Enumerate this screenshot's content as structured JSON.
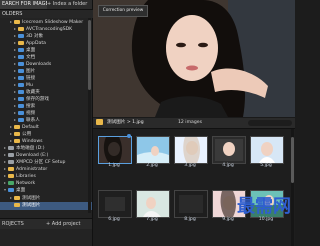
{
  "left_panel": {
    "tab_search": "EARCH FOR IMAGES",
    "tab_index": "+ Index a folder",
    "folders_heading": "OLDERS",
    "tree": [
      {
        "label": "Icecream Slideshow Maker",
        "indent": 1,
        "color": "yellow"
      },
      {
        "label": "AVCTranscodingSDK",
        "indent": 2,
        "color": "yellow"
      },
      {
        "label": "3D 对象",
        "indent": 2,
        "color": "blue"
      },
      {
        "label": "AppData",
        "indent": 2,
        "color": "yellow"
      },
      {
        "label": "桌面",
        "indent": 2,
        "color": "blue"
      },
      {
        "label": "文档",
        "indent": 2,
        "color": "blue"
      },
      {
        "label": "Downloads",
        "indent": 2,
        "color": "blue"
      },
      {
        "label": "图片",
        "indent": 2,
        "color": "blue"
      },
      {
        "label": "链接",
        "indent": 2,
        "color": "blue"
      },
      {
        "label": "Mu",
        "indent": 2,
        "color": "blue"
      },
      {
        "label": "收藏夹",
        "indent": 2,
        "color": "blue"
      },
      {
        "label": "保存的游戏",
        "indent": 2,
        "color": "blue"
      },
      {
        "label": "搜索",
        "indent": 2,
        "color": "blue"
      },
      {
        "label": "视频",
        "indent": 2,
        "color": "blue"
      },
      {
        "label": "联系人",
        "indent": 2,
        "color": "blue"
      },
      {
        "label": "Default",
        "indent": 1,
        "color": "yellow"
      },
      {
        "label": "公用",
        "indent": 1,
        "color": "yellow"
      },
      {
        "label": "Windows",
        "indent": 1,
        "color": "yellow"
      },
      {
        "label": "本地磁盘 (D:)",
        "indent": 0,
        "color": "gray"
      },
      {
        "label": "Download (E:)",
        "indent": 0,
        "color": "gray"
      },
      {
        "label": "XMPCD 分区 CF Setup",
        "indent": 0,
        "color": "gray"
      },
      {
        "label": "Administrator",
        "indent": 0,
        "color": "yellow"
      },
      {
        "label": "Libraries",
        "indent": 0,
        "color": "yellow"
      },
      {
        "label": "Network",
        "indent": 0,
        "color": "green"
      },
      {
        "label": "桌面",
        "indent": 0,
        "color": "blue"
      },
      {
        "label": "测试图片",
        "indent": 1,
        "color": "yellow"
      },
      {
        "label": "测试图片",
        "indent": 1,
        "color": "yellow",
        "selected": true
      }
    ],
    "projects_label": "ROJECTS",
    "add_project": "+ Add project"
  },
  "preview": {
    "correction_button": "Correction preview"
  },
  "list_toolbar": {
    "path": "测试图片 > 1.jpg",
    "count": "12 images"
  },
  "tiles": [
    {
      "caption": "1.jpg",
      "selected": true
    },
    {
      "caption": "2.jpg"
    },
    {
      "caption": "3.jpg"
    },
    {
      "caption": "4.jpg"
    },
    {
      "caption": "5.jpg"
    },
    {
      "caption": "6.jpg"
    },
    {
      "caption": "7.jpg"
    },
    {
      "caption": "8.jpg"
    },
    {
      "caption": "9.jpg"
    },
    {
      "caption": "10.jpg"
    }
  ],
  "watermark": "最需网",
  "colors": {
    "accent": "#4a90d9",
    "folder": "#e9b84a"
  }
}
